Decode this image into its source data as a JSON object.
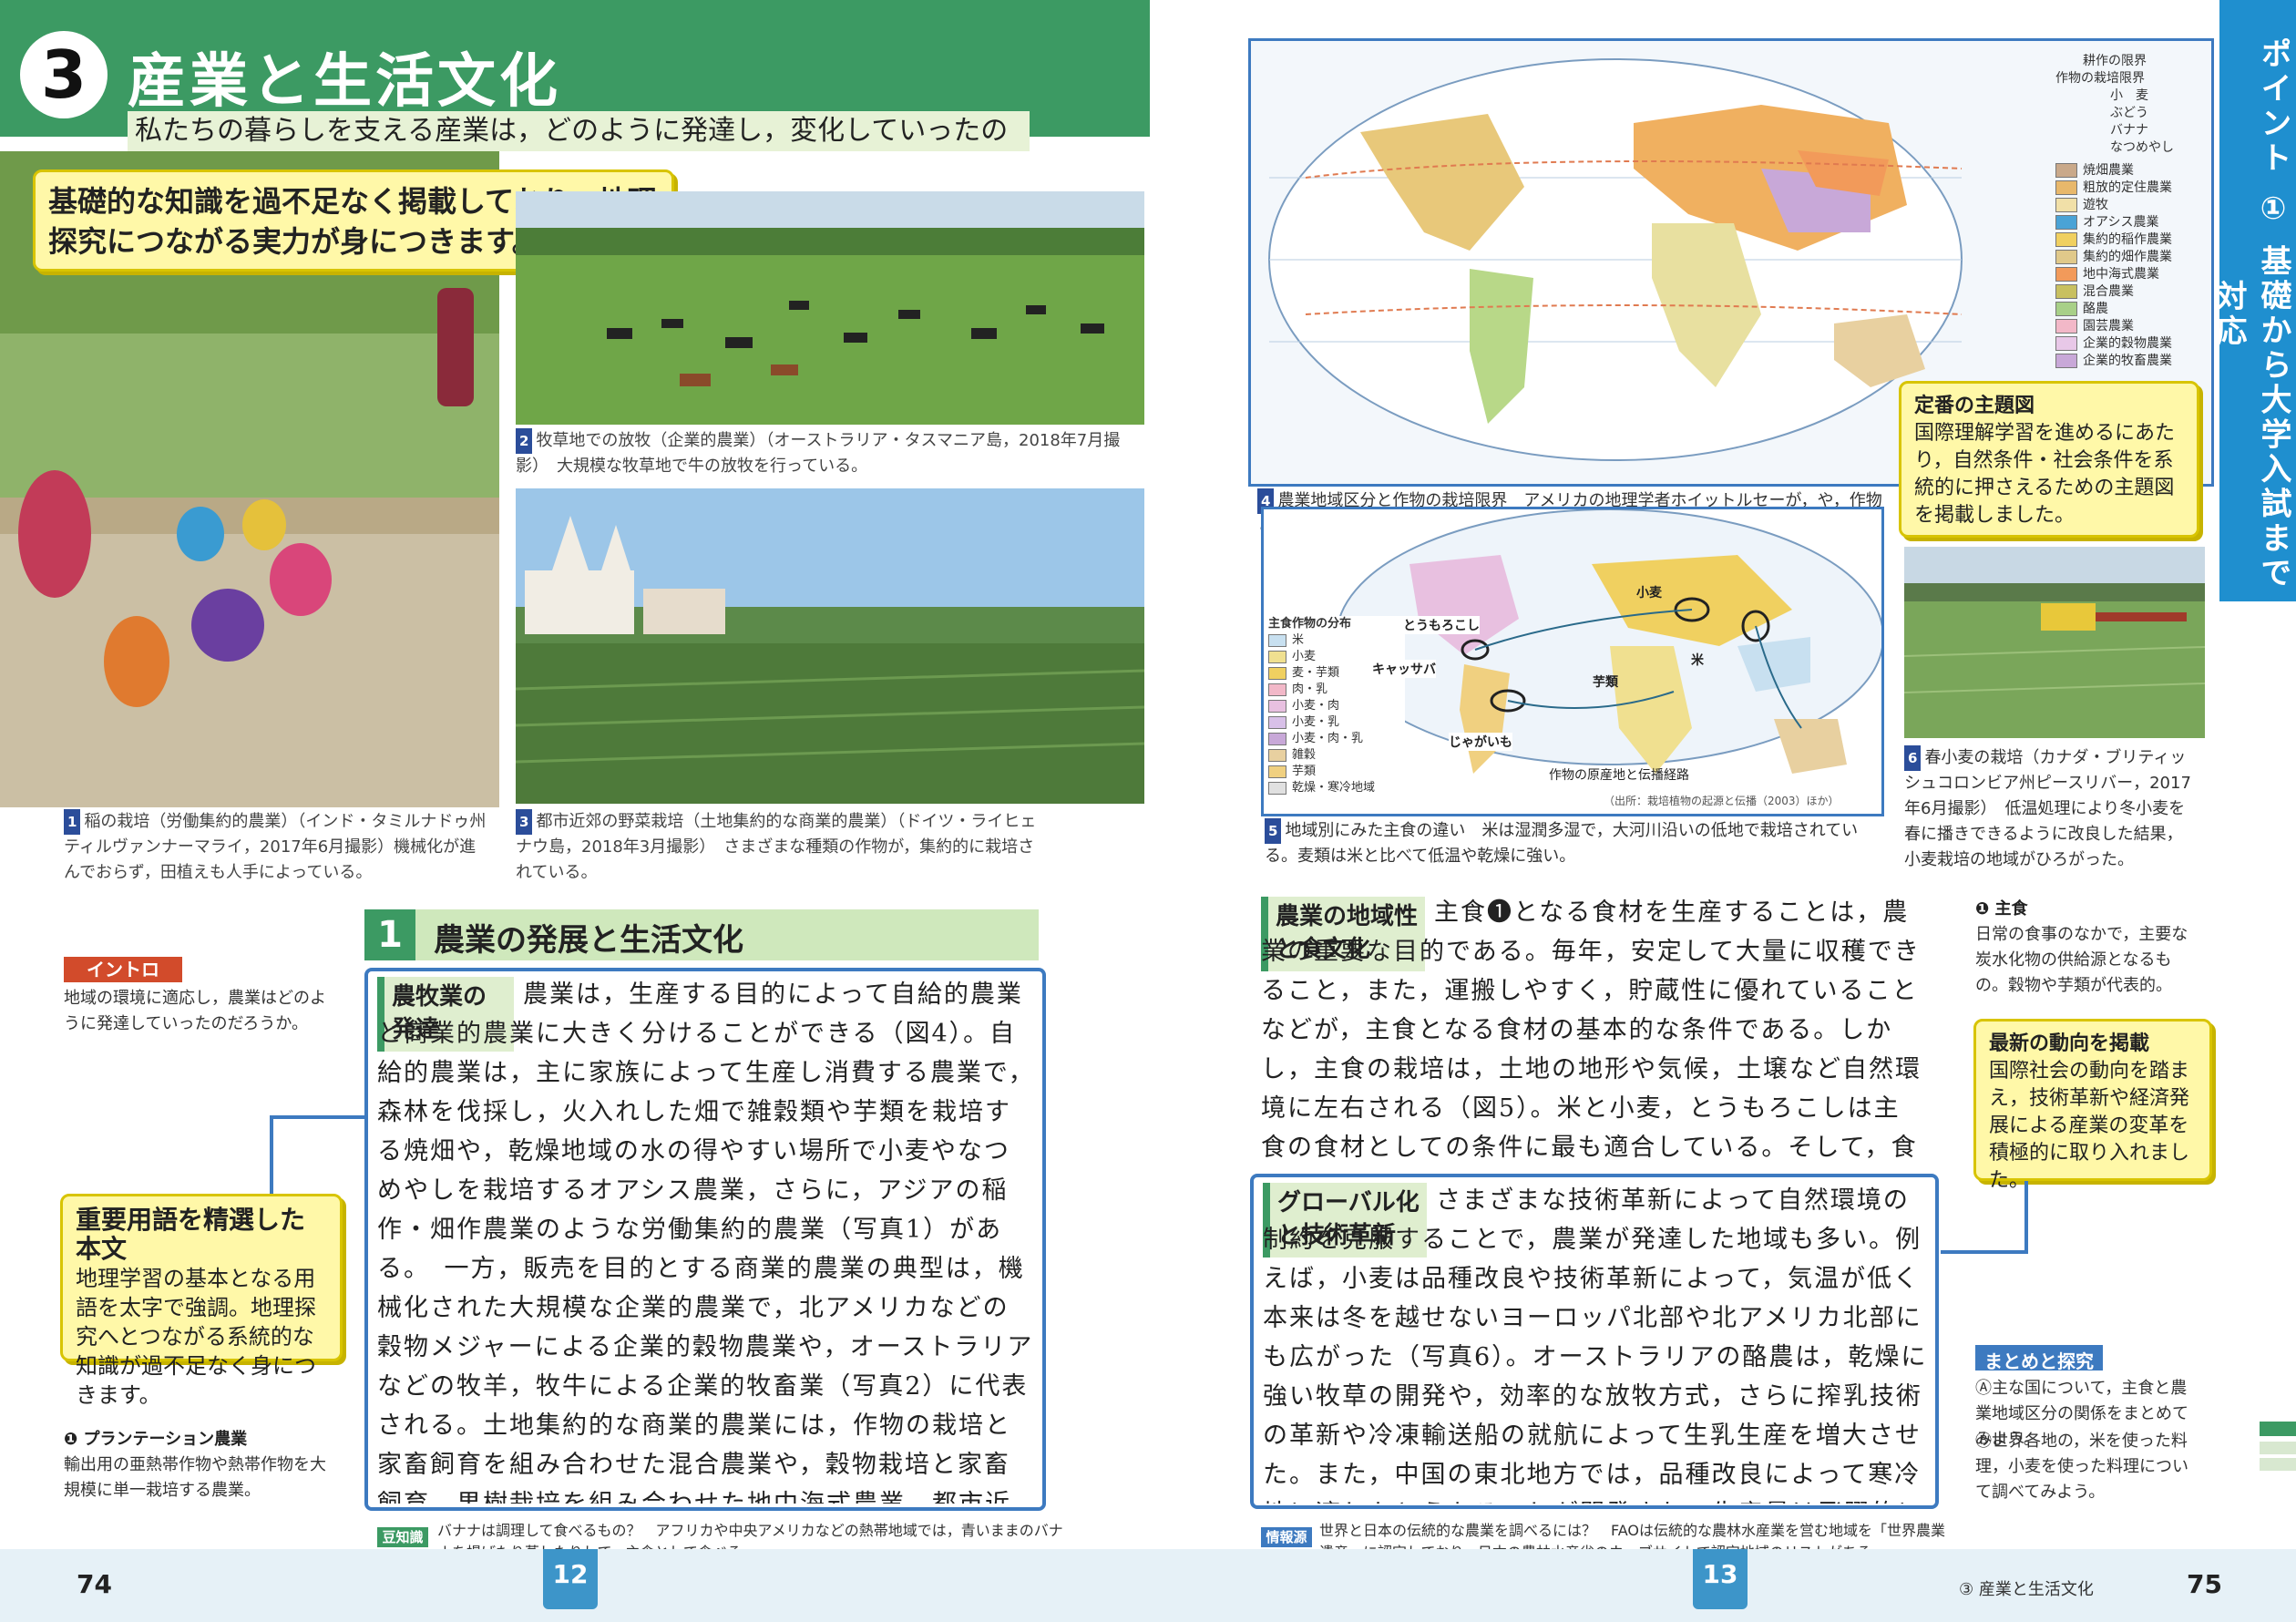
{
  "header": {
    "number": "3",
    "title": "産業と生活文化",
    "question": "私たちの暮らしを支える産業は，どのように発達し，変化していったのだろうか？"
  },
  "callouts": {
    "knowledge": "基礎的な知識を過不足なく掲載しており，地理探究につながる実力が身につきます。",
    "terms_title": "重要用語を精選した本文",
    "terms_body": "地理学習の基本となる用語を太字で強調。地理探究へとつながる系統的な知識が過不足なく身につきます。",
    "map_title": "定番の主題図",
    "map_body": "国際理解学習を進めるにあたり，自然条件・社会条件を系統的に押さえるための主題図を掲載しました。",
    "trend_title": "最新の動向を掲載",
    "trend_body": "国際社会の動向を踏まえ，技術革新や経済発展による産業の変革を積極的に取り入れました。"
  },
  "captions": {
    "p1": "稲の栽培（労働集約的農業）（インド・タミルナドゥ州ティルヴァンナーマライ，2017年6月撮影）機械化が進んでおらず，田植えも人手によっている。",
    "p2": "牧草地での放牧（企業的農業）（オーストラリア・タスマニア島，2018年7月撮影）　大規模な牧草地で牛の放牧を行っている。",
    "p3": "都市近郊の野菜栽培（土地集約的な商業的農業）（ドイツ・ライヒェナウ島，2018年3月撮影）　さまざまな種類の作物が，集約的に栽培されている。",
    "p4": "農業地域区分と作物の栽培限界　アメリカの地理学者ホイットルセーが，や，作物と家畜の生産方法，生産物の用途（自給用と販売用）などから区分した。",
    "p5": "地域別にみた主食の違い　米は湿潤多湿で，大河川沿いの低地で栽培されている。麦類は米と比べて低温や乾燥に強い。",
    "p6": "春小麦の栽培（カナダ・ブリティッシュコロンビア州ピースリバー，2017年6月撮影）　低温処理により冬小麦を春に播きできるように改良した結果，小麦栽培の地域がひろがった。"
  },
  "section": {
    "number": "1",
    "title": "農業の発展と生活文化"
  },
  "intro": {
    "label": "イントロ",
    "text": "地域の環境に適応し，農業はどのように発達していったのだろうか。"
  },
  "left_body": {
    "tag": "農牧業の発達",
    "text": "農業は，生産する目的によって自給的農業と商業的農業に大きく分けることができる（図4）。自給的農業は，主に家族によって生産し消費する農業で，森林を伐採し，火入れした畑で雑穀類や芋類を栽培する焼畑や，乾燥地域の水の得やすい場所で小麦やなつめやしを栽培するオアシス農業，さらに，アジアの稲作・畑作農業のような労働集約的農業（写真1）がある。　一方，販売を目的とする商業的農業の典型は，機械化された大規模な企業的農業で，北アメリカなどの穀物メジャーによる企業的穀物農業や，オーストラリアなどの牧羊，牧牛による企業的牧畜業（写真2）に代表される。土地集約的な商業的農業には，作物の栽培と家畜飼育を組み合わせた混合農業や，穀物栽培と家畜飼育，果樹栽培を組み合わせた地中海式農業，都市近郊で野菜や果物，花卉などを栽培する園芸農業がある（写真3）。"
  },
  "note_left": {
    "title": "❶ プランテーション農業",
    "text": "輸出用の亜熱帯作物や熱帯作物を大規模に単一栽培する農業。"
  },
  "trivia_left": {
    "label": "豆知識",
    "text": "バナナは調理して食べるもの？　アフリカや中央アメリカなどの熱帯地域では，青いままのバナナを揚げたり蒸したりして，主食として食べる。"
  },
  "right_body": {
    "tag1": "農業の地域性と食文化",
    "text1": "主食❶となる食材を生産することは，農業の重要な目的である。毎年，安定して大量に収穫できること，また，運搬しやすく，貯蔵性に優れていることなどが，主食となる食材の基本的な条件である。しかし，主食の栽培は，土地の地形や気候，土壌など自然環境に左右される（図5）。米と小麦，とうもろこしは主食の食材としての条件に最も適合している。そして，食文化は，主食となる食材が何なのかにより違ってくる。",
    "tag2": "グローバル化と技術革新",
    "text2": "さまざまな技術革新によって自然環境の制約を克服することで，農業が発達した地域も多い。例えば，小麦は品種改良や技術革新によって，気温が低く本来は冬を越せないヨーロッパ北部や北アメリカ北部にも広がった（写真6）。オーストラリアの酪農は，乾燥に強い牧草の開発や，効率的な放牧方式，さらに搾乳技術の革新や冷凍輸送船の就航によって生乳生産を増大させた。また，中国の東北地方では，品種改良によって寒冷地に適したとうもろこしが開発され，生産量は飛躍的に向上した。"
  },
  "note_right": {
    "title": "❶ 主食",
    "text": "日常の食事のなかで，主要な炭水化物の供給源となるもの。穀物や芋類が代表的。"
  },
  "matome": {
    "label": "まとめと探究",
    "a": "Ⓐ主な国について，主食と農業地域区分の関係をまとめてみよう。",
    "b": "Ⓑ世界各地の，米を使った料理，小麦を使った料理について調べてみよう。"
  },
  "info_right": {
    "label": "情報源",
    "text": "世界と日本の伝統的な農業を調べるには？　FAOは伝統的な農林水産業を営む地域を「世界農業遺産」に認定しており，日本の農林水産省のウェブサイトで認定地域のリストがある。"
  },
  "map1_legend": {
    "title1": "耕作の限界",
    "title2": "作物の栽培限界",
    "lines": [
      "小　麦",
      "ぶどう",
      "バナナ",
      "なつめやし"
    ],
    "items": [
      "焼畑農業",
      "粗放的定住農業",
      "遊牧",
      "オアシス農業",
      "集約的稲作農業",
      "集約的畑作農業",
      "地中海式農業",
      "混合農業",
      "酪農",
      "園芸農業",
      "企業的穀物農業",
      "企業的牧畜農業"
    ],
    "colors": [
      "#c9a98a",
      "#e8b86b",
      "#f1e0a8",
      "#4aa3d6",
      "#f0d060",
      "#e0c98a",
      "#f29a5a",
      "#c8c060",
      "#a8d088",
      "#f2b8c8",
      "#e8c8e8",
      "#c8a8d8"
    ]
  },
  "map2_legend": {
    "title": "主食作物の分布",
    "items": [
      "米",
      "小麦",
      "麦・芋類",
      "肉・乳",
      "小麦・肉",
      "小麦・乳",
      "小麦・肉・乳",
      "雑穀",
      "芋類",
      "乾燥・寒冷地域"
    ],
    "labels": [
      "とうもろこし",
      "キャッサバ",
      "じゃがいも",
      "芋類",
      "米",
      "小麦"
    ],
    "route": "作物の原産地と伝播経路",
    "source": "（出所：栽培植物の起源と伝播（2003）ほか）"
  },
  "side_tab": "ポイント ① 基礎から大学入試まで対応",
  "footer": {
    "left_page": "74",
    "left_tab": "12",
    "right_tab": "13",
    "right_page": "75",
    "right_title": "③ 産業と生活文化"
  },
  "colors": {
    "green": "#3c9a63",
    "blue": "#3d7ac0",
    "yellow": "#fff8a8"
  }
}
